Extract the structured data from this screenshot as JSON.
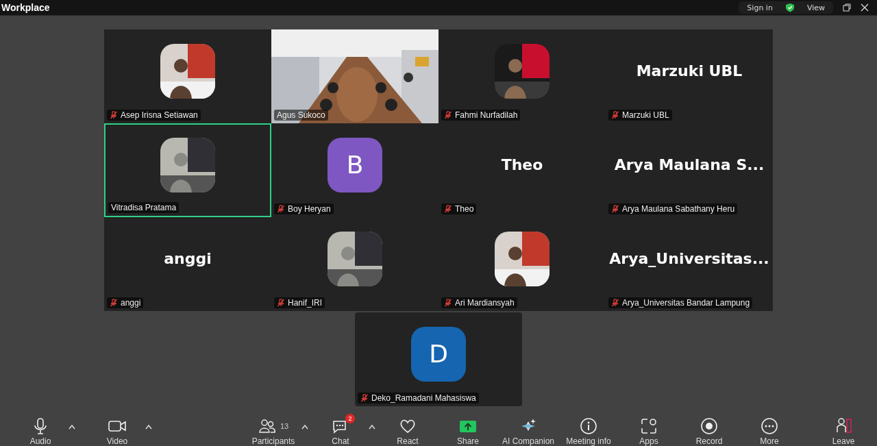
{
  "window": {
    "title": "Workplace",
    "sign_in": "Sign in",
    "view": "View"
  },
  "tiles": [
    {
      "name": "Asep Irisna Setiawan",
      "muted": true,
      "speaking": false
    },
    {
      "name": "Agus Sukoco",
      "kind": "video",
      "muted": false,
      "speaking": false
    },
    {
      "name": "Fahmi Nurfadilah",
      "muted": true,
      "speaking": false
    },
    {
      "name": "Marzuki UBL",
      "kind": "name",
      "display": "Marzuki UBL",
      "muted": true,
      "speaking": false
    },
    {
      "name": "Vitradisa Pratama",
      "muted": false,
      "speaking": true
    },
    {
      "name": "Boy Heryan",
      "kind": "letter",
      "display": "B",
      "color": "#7e57c2",
      "muted": true,
      "speaking": false
    },
    {
      "name": "Theo",
      "kind": "name",
      "display": "Theo",
      "muted": true,
      "speaking": false
    },
    {
      "name": "Arya Maulana Sabathany Heru",
      "kind": "name",
      "display": "Arya Maulana S...",
      "muted": true,
      "speaking": false
    },
    {
      "name": "anggi",
      "kind": "name",
      "display": "anggi",
      "muted": true,
      "speaking": false
    },
    {
      "name": "Hanif_IRI",
      "muted": true,
      "speaking": false
    },
    {
      "name": "Ari Mardiansyah",
      "muted": true,
      "speaking": false
    },
    {
      "name": "Arya_Universitas Bandar Lampung",
      "kind": "name",
      "display": "Arya_Universitas...",
      "muted": true,
      "speaking": false
    },
    {
      "name": "Deko_Ramadani Mahasiswa",
      "kind": "letter",
      "display": "D",
      "color": "#1565b0",
      "muted": true,
      "speaking": false
    }
  ],
  "toolbar": {
    "left": [
      {
        "label": "Audio",
        "caret": true
      },
      {
        "label": "Video",
        "caret": true
      }
    ],
    "center": [
      {
        "label": "Participants",
        "count": "13",
        "caret": true
      },
      {
        "label": "Chat",
        "badge": "2",
        "caret": true
      },
      {
        "label": "React",
        "caret": false
      },
      {
        "label": "Share",
        "caret": false
      },
      {
        "label": "AI Companion",
        "caret": false
      },
      {
        "label": "Meeting info",
        "caret": false
      },
      {
        "label": "Apps",
        "caret": false
      },
      {
        "label": "Record",
        "caret": false
      },
      {
        "label": "More",
        "caret": false
      }
    ],
    "right": [
      {
        "label": "Leave",
        "caret": false
      }
    ]
  }
}
